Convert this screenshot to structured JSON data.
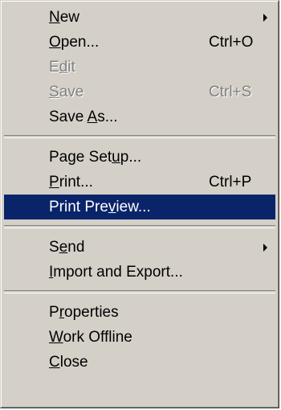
{
  "menu": {
    "items": [
      {
        "pre": "",
        "key": "N",
        "post": "ew",
        "shortcut": "",
        "submenu": true
      },
      {
        "pre": "",
        "key": "O",
        "post": "pen...",
        "shortcut": "Ctrl+O"
      },
      {
        "pre": "E",
        "key": "d",
        "post": "it",
        "shortcut": ""
      },
      {
        "pre": "",
        "key": "S",
        "post": "ave",
        "shortcut": "Ctrl+S"
      },
      {
        "pre": "Save ",
        "key": "A",
        "post": "s...",
        "shortcut": ""
      },
      {
        "pre": "Page Set",
        "key": "u",
        "post": "p...",
        "shortcut": ""
      },
      {
        "pre": "",
        "key": "P",
        "post": "rint...",
        "shortcut": "Ctrl+P"
      },
      {
        "pre": "Print Pre",
        "key": "v",
        "post": "iew...",
        "shortcut": ""
      },
      {
        "pre": "S",
        "key": "e",
        "post": "nd",
        "shortcut": "",
        "submenu": true
      },
      {
        "pre": "",
        "key": "I",
        "post": "mport and Export...",
        "shortcut": ""
      },
      {
        "pre": "P",
        "key": "r",
        "post": "operties",
        "shortcut": ""
      },
      {
        "pre": "",
        "key": "W",
        "post": "ork Offline",
        "shortcut": ""
      },
      {
        "pre": "",
        "key": "C",
        "post": "lose",
        "shortcut": ""
      }
    ]
  },
  "colors": {
    "menu_bg": "#d4d0c8",
    "highlight_bg": "#0a246a",
    "highlight_text": "#ffffff",
    "disabled_text": "#808080"
  }
}
